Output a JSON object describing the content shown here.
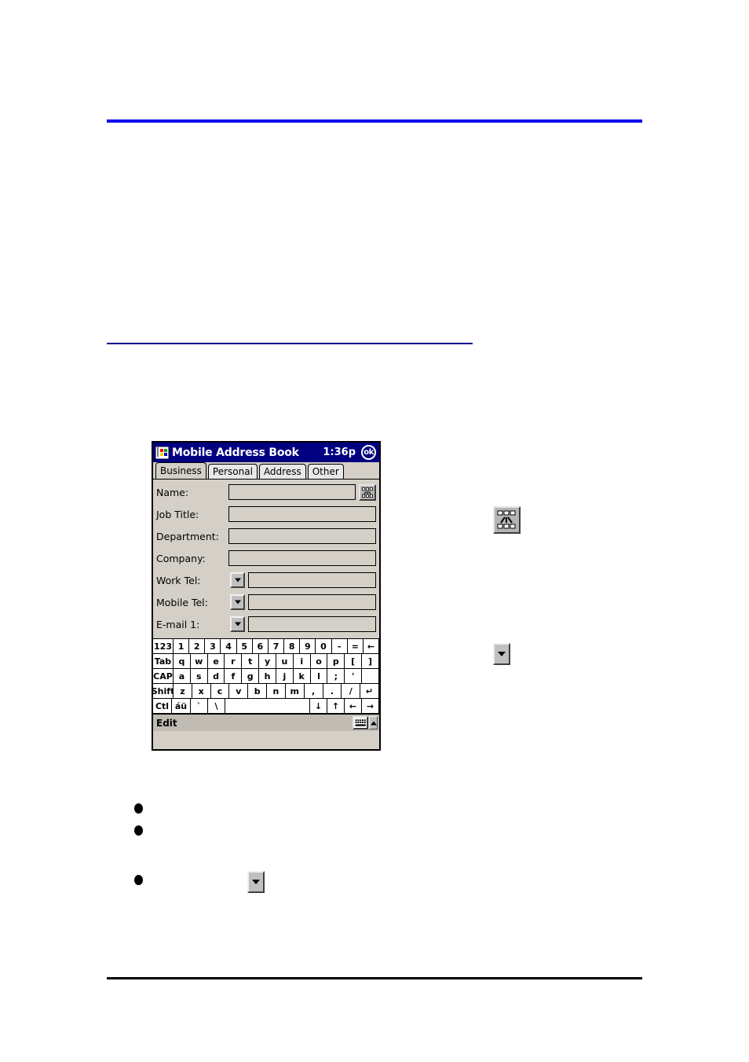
{
  "page": {
    "rules": {
      "top_color": "#0000ee",
      "mid_color": "#00008b",
      "bottom_color": "#000000"
    },
    "bullets": [
      "",
      "",
      ""
    ]
  },
  "callouts": {
    "keyboard_icon_name": "input-panel-icon",
    "dropdown_icon_name": "dropdown-arrow-icon"
  },
  "pda": {
    "titlebar": {
      "app_icon": "address-book-icon",
      "title": "Mobile Address Book",
      "time": "1:36p",
      "ok_label": "ok",
      "bg_color": "#000080",
      "text_color": "#ffffff"
    },
    "tabs": [
      {
        "label": "Business",
        "active": true
      },
      {
        "label": "Personal",
        "active": false
      },
      {
        "label": "Address",
        "active": false
      },
      {
        "label": "Other",
        "active": false
      }
    ],
    "form": {
      "fields": [
        {
          "label": "Name:",
          "value": "",
          "has_dropdown": false,
          "has_sip": true
        },
        {
          "label": "Job Title:",
          "value": "",
          "has_dropdown": false,
          "has_sip": false
        },
        {
          "label": "Department:",
          "value": "",
          "has_dropdown": false,
          "has_sip": false
        },
        {
          "label": "Company:",
          "value": "",
          "has_dropdown": false,
          "has_sip": false
        },
        {
          "label": "Work Tel:",
          "value": "",
          "has_dropdown": true,
          "has_sip": false
        },
        {
          "label": "Mobile Tel:",
          "value": "",
          "has_dropdown": true,
          "has_sip": false
        },
        {
          "label": "E-mail 1:",
          "value": "",
          "has_dropdown": true,
          "has_sip": false
        }
      ]
    },
    "keyboard": {
      "rows": [
        [
          "123",
          "1",
          "2",
          "3",
          "4",
          "5",
          "6",
          "7",
          "8",
          "9",
          "0",
          "-",
          "=",
          "←"
        ],
        [
          "Tab",
          "q",
          "w",
          "e",
          "r",
          "t",
          "y",
          "u",
          "i",
          "o",
          "p",
          "[",
          "]"
        ],
        [
          "CAP",
          "a",
          "s",
          "d",
          "f",
          "g",
          "h",
          "j",
          "k",
          "l",
          ";",
          "'",
          ""
        ],
        [
          "Shift",
          "z",
          "x",
          "c",
          "v",
          "b",
          "n",
          "m",
          ",",
          ".",
          "/",
          "↵"
        ],
        [
          "Ctl",
          "áü",
          "`",
          "\\",
          "",
          "↓",
          "↑",
          "←",
          "→"
        ]
      ]
    },
    "statusbar": {
      "label": "Edit",
      "keyboard_icon": "keyboard-icon",
      "up_arrow_icon": "chevron-up-icon",
      "bg_color": "#c0bcb4"
    }
  }
}
